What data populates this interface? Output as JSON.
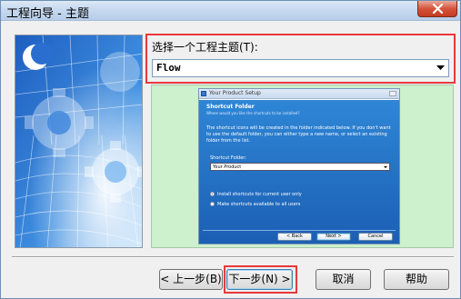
{
  "window": {
    "title": "工程向导 - 主题"
  },
  "theme_picker": {
    "label": "选择一个工程主题(T):",
    "selected": "Flow"
  },
  "preview": {
    "title": "Your Product Setup",
    "header": "Shortcut Folder",
    "subheader": "Where would you like the shortcuts to be installed?",
    "description": "The shortcut icons will be created in the folder indicated below. If you don't want to use the default folder, you can either type a new name, or select an existing folder from the list.",
    "folder_label": "Shortcut Folder:",
    "folder_value": "Your Product",
    "radio_options": [
      "Install shortcuts for current user only",
      "Make shortcuts available to all users"
    ],
    "buttons": [
      "< Back",
      "Next >",
      "Cancel"
    ]
  },
  "buttons": {
    "back": "< 上一步(B)",
    "next": "下一步(N) >",
    "cancel": "取消",
    "help": "帮助"
  },
  "colors": {
    "highlight": "#e8393b",
    "preview_background": "#ccf1cc",
    "preview_body": "#2f86d6",
    "title_bar": "#c4d7ee",
    "close_button": "#d6533b"
  },
  "icons": [
    "close-icon",
    "dropdown-arrow-icon",
    "gear-artwork"
  ]
}
